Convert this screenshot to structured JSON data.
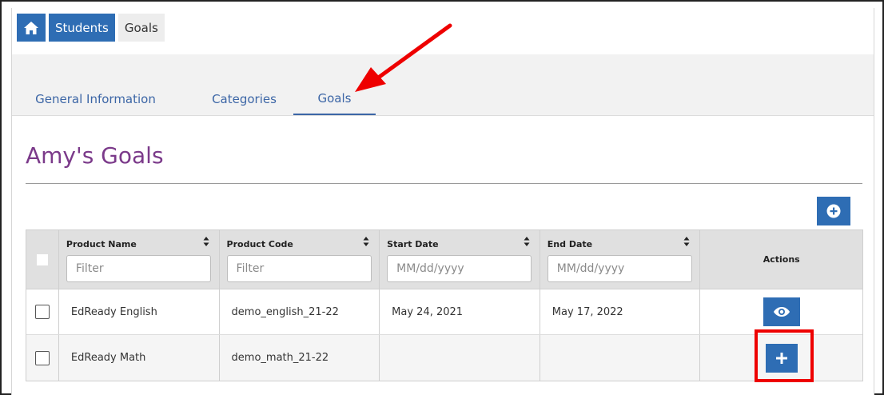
{
  "breadcrumb": {
    "home_icon": "home-icon",
    "items": [
      {
        "label": "Students"
      },
      {
        "label": "Goals"
      }
    ]
  },
  "tabs": [
    {
      "label": "General Information",
      "active": false
    },
    {
      "label": "Categories",
      "active": false
    },
    {
      "label": "Goals",
      "active": true
    }
  ],
  "page": {
    "title": "Amy's Goals"
  },
  "toolbar": {
    "add_icon": "plus-circle-icon"
  },
  "table": {
    "columns": [
      {
        "label": "Product Name",
        "filter_placeholder": "Filter"
      },
      {
        "label": "Product Code",
        "filter_placeholder": "Filter"
      },
      {
        "label": "Start Date",
        "filter_placeholder": "MM/dd/yyyy"
      },
      {
        "label": "End Date",
        "filter_placeholder": "MM/dd/yyyy"
      }
    ],
    "actions_label": "Actions",
    "rows": [
      {
        "product_name": "EdReady English",
        "product_code": "demo_english_21-22",
        "start_date": "May 24, 2021",
        "end_date": "May 17, 2022",
        "action_icon": "eye-icon"
      },
      {
        "product_name": "EdReady Math",
        "product_code": "demo_math_21-22",
        "start_date": "",
        "end_date": "",
        "action_icon": "plus-icon"
      }
    ]
  },
  "colors": {
    "accent": "#2e6db4",
    "title": "#7b3a8a",
    "tab_text": "#3c66a6",
    "annotation": "#ee0000"
  }
}
